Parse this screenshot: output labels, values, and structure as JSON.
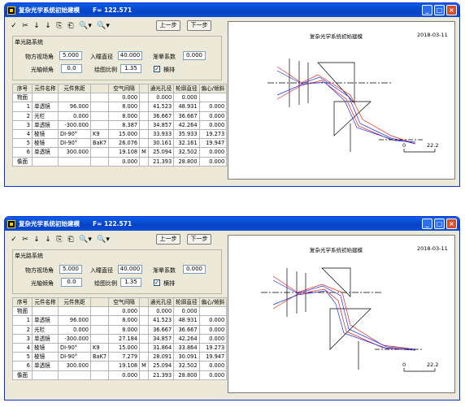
{
  "app": {
    "title": "复杂光学系统初始建模",
    "f_value": "F= 122.571"
  },
  "window_buttons": [
    "_",
    "□",
    "×"
  ],
  "toolbar": {
    "icons": [
      "✓",
      "✂",
      "↓",
      "↓",
      "⎘",
      "⎗",
      "🔍▾",
      "🔍▾"
    ],
    "prev_label": "上一步",
    "next_label": "下一步"
  },
  "system_group": {
    "title": "单光路系统",
    "field_angle_label": "物方视场角",
    "field_angle_value": "5.000",
    "pupil_label": "入瞳直径",
    "pupil_value": "40.000",
    "vignette_label": "渐晕系数",
    "vignette_value": "0.000",
    "axis_angle_label": "光轴倾角",
    "axis_angle_value": "0.0",
    "draw_scale_label": "绘图比例",
    "draw_scale_value": "1.35",
    "horizontal_label": "横排",
    "horizontal_checked": "✓"
  },
  "table": {
    "headers": [
      "序号",
      "元件名称",
      "元件焦距",
      "",
      "空气间隔",
      "",
      "通光孔径",
      "轮廓直径",
      "偏心/倾斜"
    ],
    "windows": [
      {
        "rows": [
          [
            "物面",
            "",
            "",
            "",
            "0.000",
            "",
            "0.000",
            "0.000",
            ""
          ],
          [
            "1",
            "单透镜",
            "96.000",
            "",
            "8.000",
            "",
            "41.523",
            "48.931",
            "0.000"
          ],
          [
            "2",
            "光栏",
            "0.000",
            "",
            "8.000",
            "",
            "36.667",
            "36.667",
            "0.000"
          ],
          [
            "3",
            "单透镜",
            "-300.000",
            "",
            "8.387",
            "",
            "34.857",
            "42.264",
            "0.000"
          ],
          [
            "4",
            "棱镜",
            "DⅠ-90°",
            "K9",
            "15.000",
            "",
            "33.933",
            "35.933",
            "19.273"
          ],
          [
            "5",
            "棱镜",
            "DⅠ-90°",
            "BaK7",
            "26.076",
            "",
            "30.161",
            "32.161",
            "19.947"
          ],
          [
            "6",
            "单透镜",
            "300.000",
            "",
            "19.108",
            "M",
            "25.094",
            "32.502",
            "0.000"
          ],
          [
            "像面",
            "",
            "",
            "",
            "0.000",
            "",
            "21.393",
            "28.800",
            "0.000"
          ]
        ]
      },
      {
        "rows": [
          [
            "物面",
            "",
            "",
            "",
            "0.000",
            "",
            "0.000",
            "0.000",
            ""
          ],
          [
            "1",
            "单透镜",
            "96.000",
            "",
            "8.000",
            "",
            "41.523",
            "48.931",
            "0.000"
          ],
          [
            "2",
            "光栏",
            "0.000",
            "",
            "8.000",
            "",
            "36.667",
            "36.667",
            "0.000"
          ],
          [
            "3",
            "单透镜",
            "-300.000",
            "",
            "27.184",
            "",
            "34.857",
            "42.264",
            "0.000"
          ],
          [
            "4",
            "棱镜",
            "DⅠ-90°",
            "K9",
            "15.000",
            "",
            "31.864",
            "33.864",
            "19.273"
          ],
          [
            "5",
            "棱镜",
            "DⅠ-90°",
            "BaK7",
            "7.279",
            "",
            "28.091",
            "30.091",
            "19.947"
          ],
          [
            "6",
            "单透镜",
            "300.000",
            "",
            "19.108",
            "M",
            "25.094",
            "32.502",
            "0.000"
          ],
          [
            "像面",
            "",
            "",
            "",
            "0.000",
            "",
            "21.393",
            "28.800",
            "0.000"
          ]
        ]
      }
    ]
  },
  "canvas": {
    "title": "复杂光学系统初始建模",
    "date": "2018-03-11",
    "scale_zero": "0",
    "scale_value": "22.2"
  }
}
